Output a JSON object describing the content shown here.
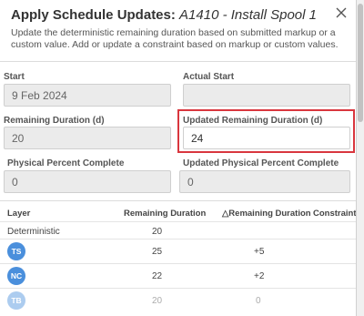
{
  "dialog": {
    "title": "Apply Schedule Updates:",
    "subtitle": "A1410 - Install Spool 1",
    "description": "Update the deterministic remaining duration based on submitted markup or a custom value. Add or update a constraint based on markup or custom values.",
    "close_icon": "close-icon"
  },
  "fields": {
    "start_label": "Start",
    "start_value": "9 Feb 2024",
    "actual_start_label": "Actual Start",
    "actual_start_value": "",
    "remaining_duration_label": "Remaining Duration (d)",
    "remaining_duration_value": "20",
    "updated_remaining_duration_label": "Updated Remaining Duration (d)",
    "updated_remaining_duration_value": "24",
    "physical_percent_label": "Physical Percent Complete",
    "physical_percent_value": "0",
    "updated_physical_percent_label": "Updated Physical Percent Complete",
    "updated_physical_percent_value": "0"
  },
  "table": {
    "headers": {
      "layer": "Layer",
      "remaining_duration": "Remaining Duration",
      "delta_remaining_duration": "△Remaining Duration",
      "constraint": "Constraint"
    },
    "rows": [
      {
        "layer": "Deterministic",
        "remaining": "20",
        "delta": "",
        "constraint": ""
      },
      {
        "avatar": "TS",
        "remaining": "25",
        "delta": "+5",
        "constraint": ""
      },
      {
        "avatar": "NC",
        "remaining": "22",
        "delta": "+2",
        "constraint": ""
      },
      {
        "avatar": "TB",
        "remaining": "20",
        "delta": "0",
        "constraint": ""
      }
    ]
  },
  "colors": {
    "highlight": "#d9363e",
    "avatar": "#4a8fdc"
  }
}
